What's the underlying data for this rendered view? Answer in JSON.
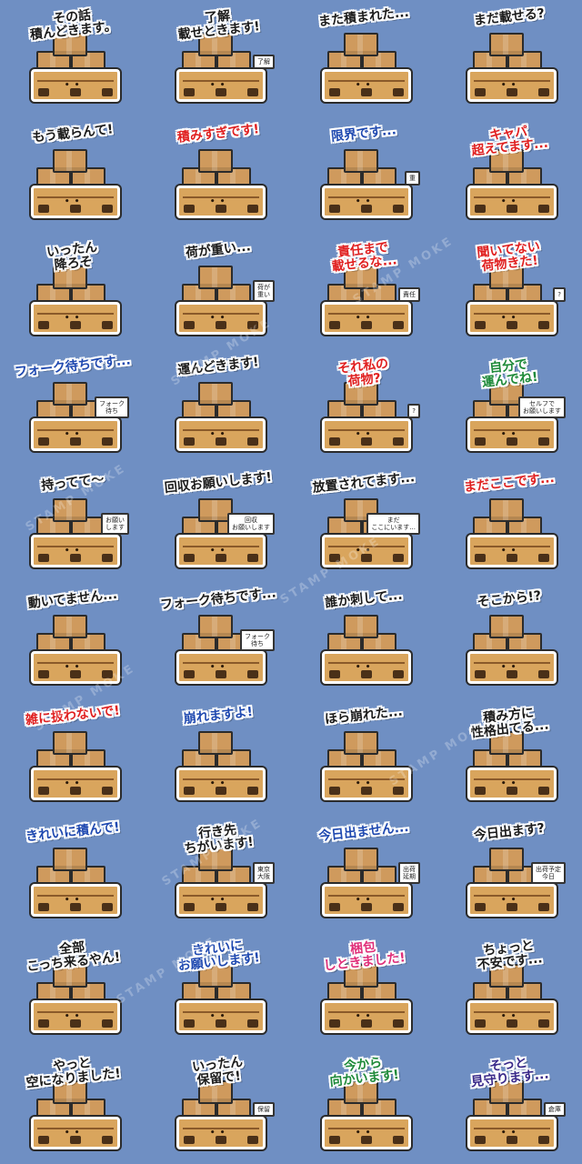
{
  "watermark": "STAMP MOKE",
  "stickers": [
    {
      "caption": "その話\n積んどきます。",
      "color": "",
      "sign": ""
    },
    {
      "caption": "了解\n載せときます!",
      "color": "",
      "sign": "了解"
    },
    {
      "caption": "また積まれた...",
      "color": "",
      "sign": ""
    },
    {
      "caption": "まだ載せる?",
      "color": "",
      "sign": ""
    },
    {
      "caption": "もう載らんて!",
      "color": "",
      "sign": ""
    },
    {
      "caption": "積みすぎです!",
      "color": "red",
      "sign": ""
    },
    {
      "caption": "限界です...",
      "color": "blue",
      "sign": "重"
    },
    {
      "caption": "キャパ\n超えてます...",
      "color": "red",
      "sign": ""
    },
    {
      "caption": "いったん\n降ろそ",
      "color": "",
      "sign": ""
    },
    {
      "caption": "荷が重い...",
      "color": "",
      "sign": "荷が\n重い"
    },
    {
      "caption": "責任まで\n載せるな...",
      "color": "red",
      "sign": "責任"
    },
    {
      "caption": "聞いてない\n荷物きた!",
      "color": "red",
      "sign": "?"
    },
    {
      "caption": "フォーク待ちです...",
      "color": "blue",
      "sign": "フォーク\n待ち"
    },
    {
      "caption": "運んどきます!",
      "color": "",
      "sign": ""
    },
    {
      "caption": "それ私の\n荷物?",
      "color": "red",
      "sign": "?"
    },
    {
      "caption": "自分で\n運んでね!",
      "color": "green",
      "sign": "セルフで\nお願いします"
    },
    {
      "caption": "持ってて〜",
      "color": "",
      "sign": "お願い\nします"
    },
    {
      "caption": "回収お願いします!",
      "color": "",
      "sign": "回収\nお願いします"
    },
    {
      "caption": "放置されてます...",
      "color": "",
      "sign": "まだ\nここにいます..."
    },
    {
      "caption": "まだここです...",
      "color": "red",
      "sign": ""
    },
    {
      "caption": "動いてません...",
      "color": "",
      "sign": ""
    },
    {
      "caption": "フォーク待ちです...",
      "color": "",
      "sign": "フォーク\n待ち"
    },
    {
      "caption": "誰か刺して...",
      "color": "",
      "sign": ""
    },
    {
      "caption": "そこから!?",
      "color": "",
      "sign": ""
    },
    {
      "caption": "雑に扱わないで!",
      "color": "red",
      "sign": ""
    },
    {
      "caption": "崩れますよ!",
      "color": "blue",
      "sign": ""
    },
    {
      "caption": "ほら崩れた...",
      "color": "",
      "sign": ""
    },
    {
      "caption": "積み方に\n性格出てる...",
      "color": "",
      "sign": ""
    },
    {
      "caption": "きれいに積んで!",
      "color": "blue",
      "sign": ""
    },
    {
      "caption": "行き先\nちがいます!",
      "color": "",
      "sign": "東京\n大阪"
    },
    {
      "caption": "今日出ません...",
      "color": "blue",
      "sign": "出荷\n延期"
    },
    {
      "caption": "今日出ます?",
      "color": "",
      "sign": "出荷予定\n今日"
    },
    {
      "caption": "全部\nこっち来るやん!",
      "color": "",
      "sign": ""
    },
    {
      "caption": "きれいに\nお願いします!",
      "color": "blue",
      "sign": ""
    },
    {
      "caption": "梱包\nしときました!",
      "color": "pink",
      "sign": ""
    },
    {
      "caption": "ちょっと\n不安です...",
      "color": "",
      "sign": ""
    },
    {
      "caption": "やっと\n空になりました!",
      "color": "",
      "sign": ""
    },
    {
      "caption": "いったん\n保留で!",
      "color": "",
      "sign": "保留"
    },
    {
      "caption": "今から\n向かいます!",
      "color": "green",
      "sign": ""
    },
    {
      "caption": "そっと\n見守ります...",
      "color": "purple",
      "sign": "倉庫"
    }
  ]
}
